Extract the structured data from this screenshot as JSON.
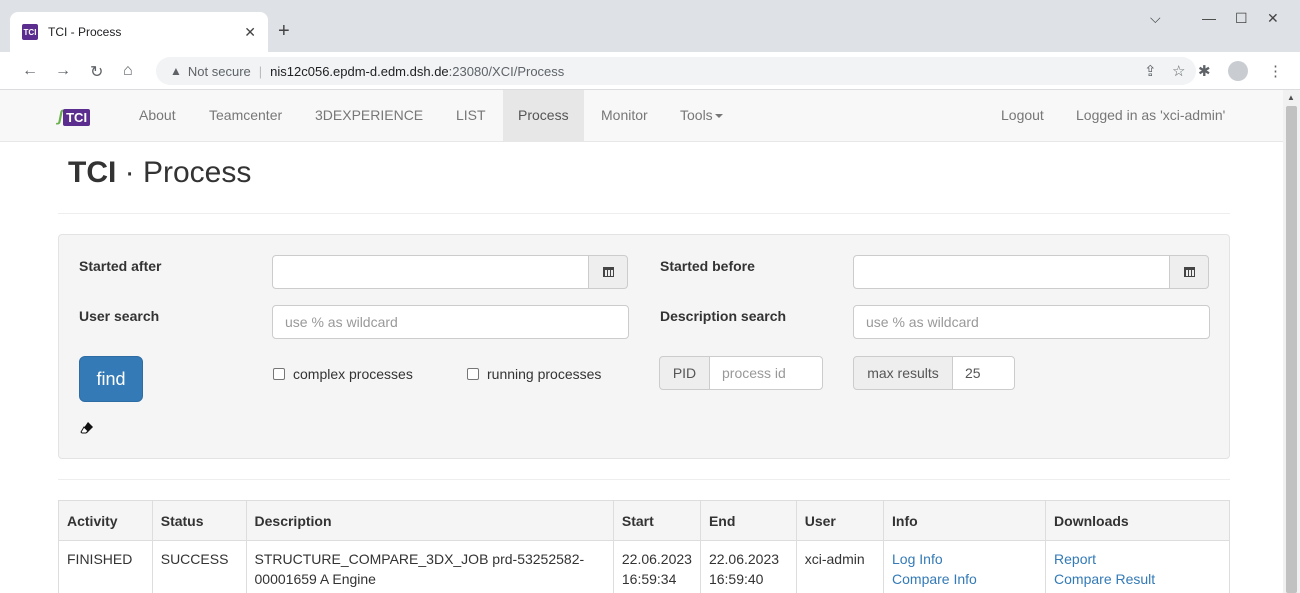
{
  "browser": {
    "tab_title": "TCI - Process",
    "tab_favicon": "TCI",
    "url_warning": "Not secure",
    "url_host": "nis12c056.epdm-d.edm.dsh.de",
    "url_path": ":23080/XCI/Process"
  },
  "nav": {
    "logo_text": "TCI",
    "items": [
      "About",
      "Teamcenter",
      "3DEXPERIENCE",
      "LIST",
      "Process",
      "Monitor",
      "Tools"
    ],
    "active": "Process",
    "logout": "Logout",
    "logged_in": "Logged in as 'xci-admin'"
  },
  "page": {
    "title_bold": "TCI",
    "title_rest": " · Process"
  },
  "search": {
    "started_after_label": "Started after",
    "started_before_label": "Started before",
    "user_search_label": "User search",
    "description_search_label": "Description search",
    "user_placeholder": "use % as wildcard",
    "description_placeholder": "use % as wildcard",
    "find_label": "find",
    "complex_label": "complex processes",
    "running_label": "running processes",
    "pid_label": "PID",
    "pid_placeholder": "process id",
    "max_results_label": "max results",
    "max_results_value": "25"
  },
  "table": {
    "headers": [
      "Activity",
      "Status",
      "Description",
      "Start",
      "End",
      "User",
      "Info",
      "Downloads"
    ],
    "rows": [
      {
        "activity": "FINISHED",
        "status": "SUCCESS",
        "description": "STRUCTURE_COMPARE_3DX_JOB prd-53252582-00001659 A Engine",
        "start_date": "22.06.2023",
        "start_time": "16:59:34",
        "end_date": "22.06.2023",
        "end_time": "16:59:40",
        "user": "xci-admin",
        "info_links": [
          "Log Info",
          "Compare Info"
        ],
        "download_links": [
          "Report",
          "Compare Result"
        ]
      }
    ]
  },
  "colors": {
    "primary": "#337ab7",
    "brand_purple": "#5b2d8e",
    "brand_green": "#6ab04c"
  }
}
